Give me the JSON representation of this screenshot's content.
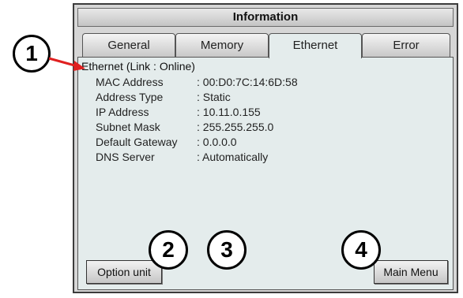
{
  "window": {
    "title": "Information"
  },
  "tabs": [
    {
      "label": "General"
    },
    {
      "label": "Memory"
    },
    {
      "label": "Ethernet"
    },
    {
      "label": "Error"
    }
  ],
  "ethernet": {
    "heading": "Ethernet (Link : Online)",
    "rows": [
      {
        "label": "MAC Address",
        "value": ": 00:D0:7C:14:6D:58"
      },
      {
        "label": "Address Type",
        "value": ": Static"
      },
      {
        "label": "IP Address",
        "value": ": 10.11.0.155"
      },
      {
        "label": "Subnet Mask",
        "value": ": 255.255.255.0"
      },
      {
        "label": "Default Gateway",
        "value": ": 0.0.0.0"
      },
      {
        "label": "DNS Server",
        "value": ": Automatically"
      }
    ]
  },
  "buttons": {
    "option_unit": "Option unit",
    "main_menu": "Main Menu"
  },
  "callouts": [
    "1",
    "2",
    "3",
    "4"
  ],
  "colors": {
    "arrow": "#e02020"
  }
}
